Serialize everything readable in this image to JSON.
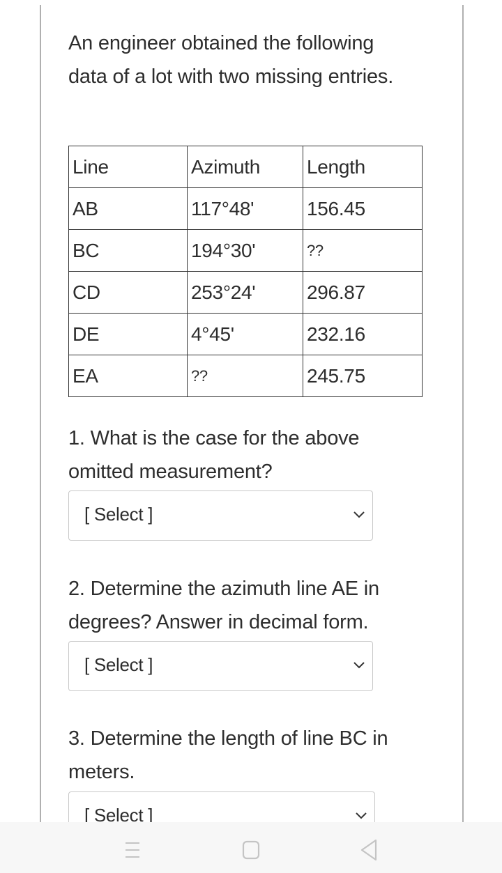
{
  "intro": "An engineer obtained the following data of a lot with two missing entries.",
  "table": {
    "headers": [
      "Line",
      "Azimuth",
      "Length"
    ],
    "rows": [
      [
        "AB",
        "117°48'",
        "156.45"
      ],
      [
        "BC",
        "194°30'",
        "??"
      ],
      [
        "CD",
        "253°24'",
        "296.87"
      ],
      [
        "DE",
        "4°45'",
        "232.16"
      ],
      [
        "EA",
        "??",
        "245.75"
      ]
    ]
  },
  "questions": [
    {
      "text": "1. What is the case for the above omitted measurement?",
      "selected": "[ Select ]"
    },
    {
      "text": "2. Determine the azimuth line AE in degrees? Answer in decimal form.",
      "selected": "[ Select ]"
    },
    {
      "text": "3. Determine the length of line BC in meters.",
      "selected": "[ Select ]"
    }
  ],
  "navbar": {
    "icons": [
      "recents-icon",
      "home-icon",
      "back-icon"
    ]
  }
}
